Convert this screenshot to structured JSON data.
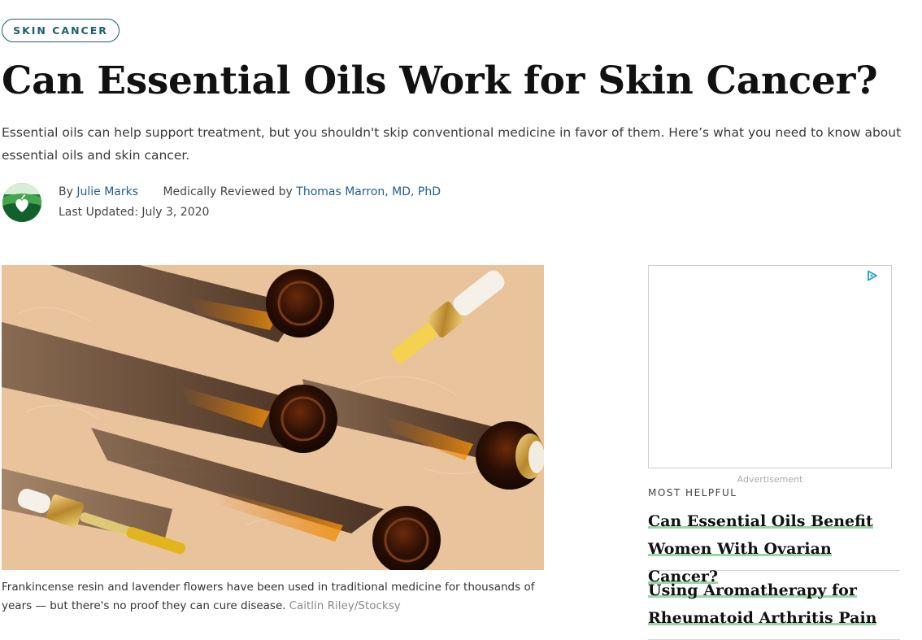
{
  "category_tag": "SKIN CANCER",
  "article": {
    "title": "Can Essential Oils Work for Skin Cancer?",
    "subtitle": "Essential oils can help support treatment, but you shouldn't skip conventional medicine in favor of them. Here’s what you need to know about essential oils and skin cancer.",
    "byline": {
      "by_prefix": "By",
      "author": "Julie Marks",
      "reviewed_prefix": "Medically Reviewed by",
      "reviewer": "Thomas Marron, MD, PhD",
      "updated_prefix": "Last Updated:",
      "updated_date": "July 3, 2020"
    },
    "image": {
      "caption": "Frankincense resin and lavender flowers have been used in traditional medicine for thousands of years — but there's no proof they can cure disease.",
      "credit": "Caitlin Riley/Stocksy"
    }
  },
  "sidebar": {
    "ad_label": "Advertisement",
    "most_helpful_heading": "MOST HELPFUL",
    "most_helpful": [
      {
        "title": "Can Essential Oils Benefit Women With Ovarian Cancer?"
      },
      {
        "title": "Using Aromatherapy for Rheumatoid Arthritis Pain"
      }
    ]
  },
  "colors": {
    "tag_border": "#1f5f6b",
    "link": "#1f5f8f",
    "underline_accent": "#9ad7a8"
  },
  "icons": {
    "avatar": "everyday-health-heart-logo",
    "ad": "adchoices-play-icon"
  }
}
